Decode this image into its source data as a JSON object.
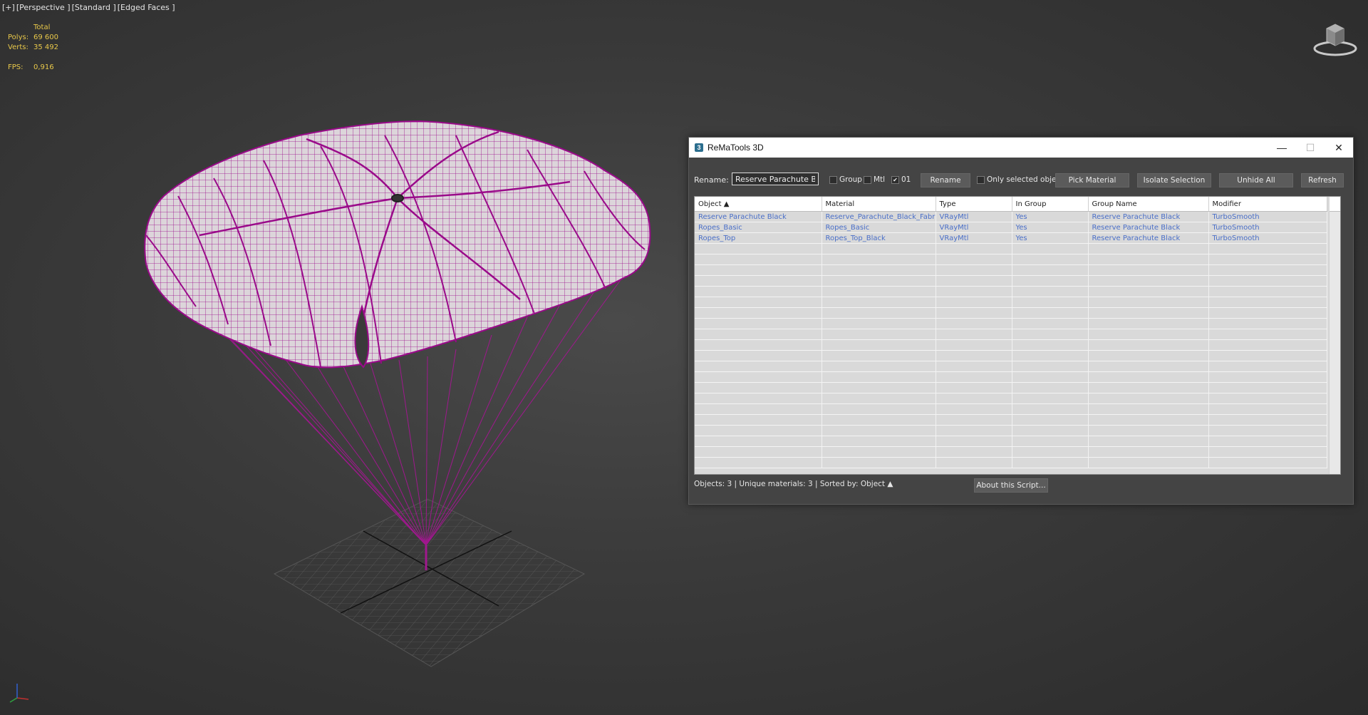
{
  "viewport": {
    "labels": [
      "[+]",
      "[Perspective ]",
      "[Standard ]",
      "[Edged Faces ]"
    ],
    "stats": {
      "header": "Total",
      "polys_label": "Polys:",
      "polys_value": "69 600",
      "verts_label": "Verts:",
      "verts_value": "35 492",
      "fps_label": "FPS:",
      "fps_value": "0,916"
    },
    "icons": [
      "viewcube-icon",
      "axis-tripod-icon"
    ],
    "colors": {
      "wire": "#9a0a8a",
      "mesh": "#ddd6dc"
    }
  },
  "dialog": {
    "title": "ReMaTools 3D",
    "icon_glyph": "3",
    "controls": {
      "minimize": "—",
      "maximize": "☐",
      "close": "✕"
    },
    "rename_label": "Rename:",
    "rename_value": "Reserve Parachute Black",
    "check_group": "Group",
    "check_mtl": "Mtl",
    "check_01": "01",
    "check_01_mark": "✔",
    "buttons": {
      "rename": "Rename",
      "only_selected": "Only selected objects",
      "pick_material": "Pick Material",
      "isolate": "Isolate Selection",
      "unhide": "Unhide All",
      "refresh": "Refresh",
      "about": "About this Script..."
    },
    "columns": [
      "Object ▲",
      "Material",
      "Type",
      "In Group",
      "Group Name",
      "Modifier"
    ],
    "rows": [
      [
        "Reserve Parachute Black",
        "Reserve_Parachute_Black_Fabric",
        "VRayMtl",
        "Yes",
        "Reserve Parachute Black",
        "TurboSmooth"
      ],
      [
        "Ropes_Basic",
        "Ropes_Basic",
        "VRayMtl",
        "Yes",
        "Reserve Parachute Black",
        "TurboSmooth"
      ],
      [
        "Ropes_Top",
        "Ropes_Top_Black",
        "VRayMtl",
        "Yes",
        "Reserve Parachute Black",
        "TurboSmooth"
      ]
    ],
    "status": "Objects: 3 | Unique materials: 3 | Sorted by: Object ▲"
  }
}
